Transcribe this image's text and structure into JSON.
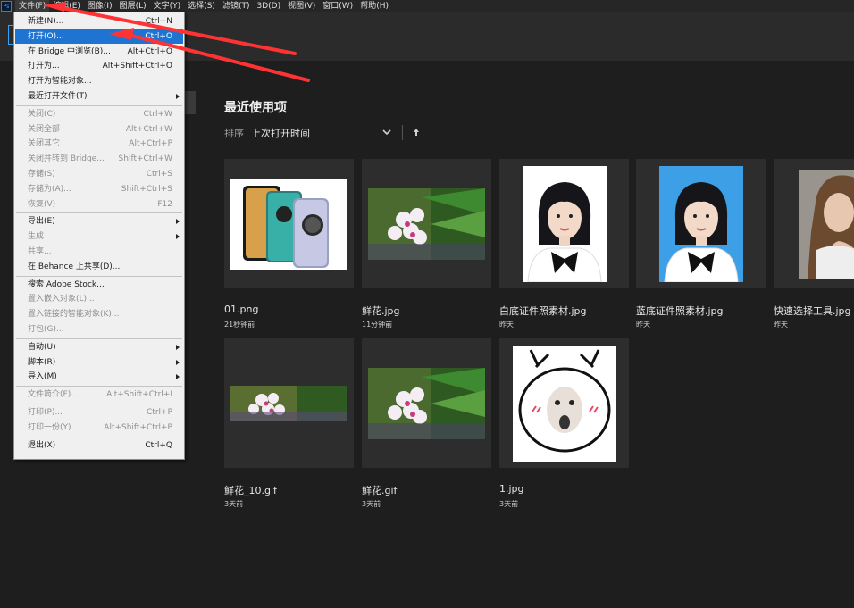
{
  "app": {
    "logo_text": "Ps"
  },
  "menubar": [
    {
      "label": "文件(F)",
      "active": true
    },
    {
      "label": "编辑(E)",
      "active": false
    },
    {
      "label": "图像(I)",
      "active": false
    },
    {
      "label": "图层(L)",
      "active": false
    },
    {
      "label": "文字(Y)",
      "active": false
    },
    {
      "label": "选择(S)",
      "active": false
    },
    {
      "label": "滤镜(T)",
      "active": false
    },
    {
      "label": "3D(D)",
      "active": false
    },
    {
      "label": "视图(V)",
      "active": false
    },
    {
      "label": "窗口(W)",
      "active": false
    },
    {
      "label": "帮助(H)",
      "active": false
    }
  ],
  "file_menu": [
    {
      "type": "item",
      "label": "新建(N)...",
      "shortcut": "Ctrl+N"
    },
    {
      "type": "item",
      "label": "打开(O)...",
      "shortcut": "Ctrl+O",
      "highlighted": true
    },
    {
      "type": "item",
      "label": "在 Bridge 中浏览(B)...",
      "shortcut": "Alt+Ctrl+O"
    },
    {
      "type": "item",
      "label": "打开为...",
      "shortcut": "Alt+Shift+Ctrl+O"
    },
    {
      "type": "item",
      "label": "打开为智能对象..."
    },
    {
      "type": "item",
      "label": "最近打开文件(T)",
      "submenu": true
    },
    {
      "type": "sep"
    },
    {
      "type": "item",
      "label": "关闭(C)",
      "shortcut": "Ctrl+W",
      "disabled": true
    },
    {
      "type": "item",
      "label": "关闭全部",
      "shortcut": "Alt+Ctrl+W",
      "disabled": true
    },
    {
      "type": "item",
      "label": "关闭其它",
      "shortcut": "Alt+Ctrl+P",
      "disabled": true
    },
    {
      "type": "item",
      "label": "关闭并转到 Bridge...",
      "shortcut": "Shift+Ctrl+W",
      "disabled": true
    },
    {
      "type": "item",
      "label": "存储(S)",
      "shortcut": "Ctrl+S",
      "disabled": true
    },
    {
      "type": "item",
      "label": "存储为(A)...",
      "shortcut": "Shift+Ctrl+S",
      "disabled": true
    },
    {
      "type": "item",
      "label": "恢复(V)",
      "shortcut": "F12",
      "disabled": true
    },
    {
      "type": "sep"
    },
    {
      "type": "item",
      "label": "导出(E)",
      "submenu": true
    },
    {
      "type": "item",
      "label": "生成",
      "submenu": true,
      "disabled": true
    },
    {
      "type": "item",
      "label": "共享...",
      "disabled": true
    },
    {
      "type": "item",
      "label": "在 Behance 上共享(D)..."
    },
    {
      "type": "sep"
    },
    {
      "type": "item",
      "label": "搜索 Adobe Stock..."
    },
    {
      "type": "item",
      "label": "置入嵌入对象(L)...",
      "disabled": true
    },
    {
      "type": "item",
      "label": "置入链接的智能对象(K)...",
      "disabled": true
    },
    {
      "type": "item",
      "label": "打包(G)...",
      "disabled": true
    },
    {
      "type": "sep"
    },
    {
      "type": "item",
      "label": "自动(U)",
      "submenu": true
    },
    {
      "type": "item",
      "label": "脚本(R)",
      "submenu": true
    },
    {
      "type": "item",
      "label": "导入(M)",
      "submenu": true
    },
    {
      "type": "sep"
    },
    {
      "type": "item",
      "label": "文件简介(F)...",
      "shortcut": "Alt+Shift+Ctrl+I",
      "disabled": true
    },
    {
      "type": "sep"
    },
    {
      "type": "item",
      "label": "打印(P)...",
      "shortcut": "Ctrl+P",
      "disabled": true
    },
    {
      "type": "item",
      "label": "打印一份(Y)",
      "shortcut": "Alt+Shift+Ctrl+P",
      "disabled": true
    },
    {
      "type": "sep"
    },
    {
      "type": "item",
      "label": "退出(X)",
      "shortcut": "Ctrl+Q"
    }
  ],
  "home": {
    "title": "最近使用项",
    "sort_label": "排序",
    "sort_value": "上次打开时间"
  },
  "recent_files": [
    {
      "name": "01.png",
      "time": "21秒钟前",
      "thumb": "phone"
    },
    {
      "name": "鲜花.jpg",
      "time": "11分钟前",
      "thumb": "flower"
    },
    {
      "name": "白底证件照素材.jpg",
      "time": "昨天",
      "thumb": "id-white"
    },
    {
      "name": "蓝底证件照素材.jpg",
      "time": "昨天",
      "thumb": "id-blue"
    },
    {
      "name": "快速选择工具.jpg",
      "time": "昨天",
      "thumb": "portrait"
    },
    {
      "name": "鲜花_10.gif",
      "time": "3天前",
      "thumb": "flower-wide"
    },
    {
      "name": "鲜花.gif",
      "time": "3天前",
      "thumb": "flower"
    },
    {
      "name": "1.jpg",
      "time": "3天前",
      "thumb": "meme"
    }
  ],
  "colors": {
    "highlight": "#1f73d1",
    "annotation": "#ff3333",
    "id_blue_bg": "#3d9fe6"
  }
}
